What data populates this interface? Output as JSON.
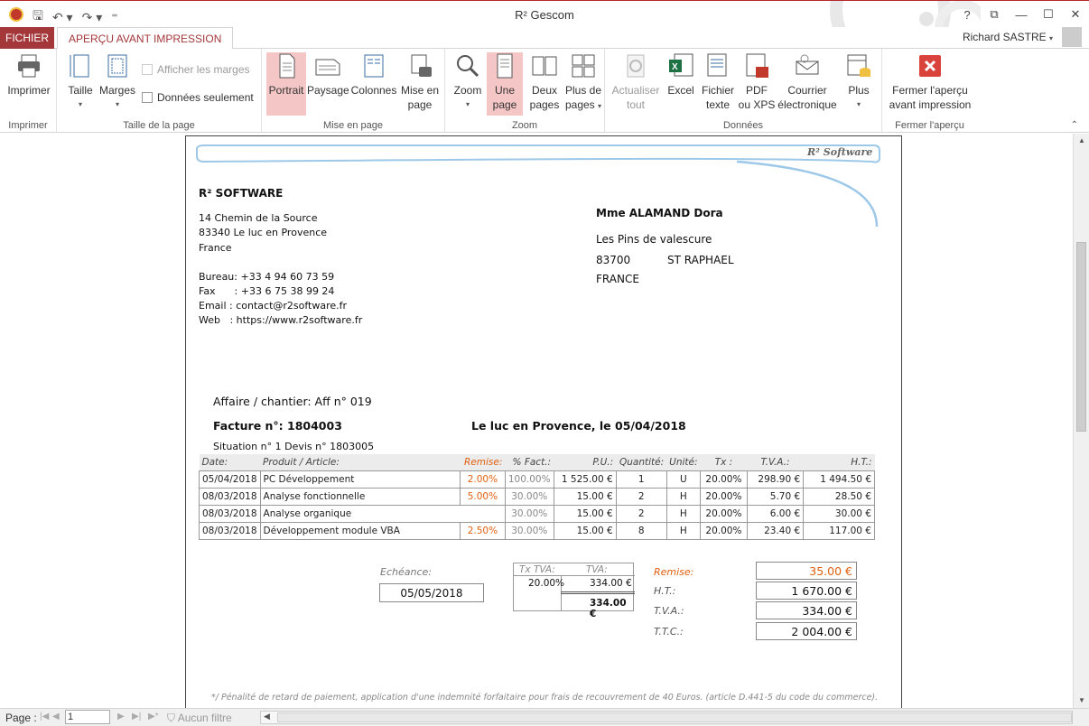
{
  "window": {
    "title": "R² Gescom",
    "user": "Richard SASTRE",
    "help": "?",
    "controls": {
      "restore": "⧉",
      "minimize": "—",
      "maximize": "☐",
      "close": "✕"
    }
  },
  "tabs": {
    "fichier": "FICHIER",
    "apercu": "APERÇU AVANT IMPRESSION"
  },
  "ribbon": {
    "imprimer": {
      "button": "Imprimer",
      "group": "Imprimer"
    },
    "taille": {
      "group": "Taille de la page",
      "taille": "Taille",
      "marges": "Marges",
      "afficher_marges": "Afficher les marges",
      "donnees_seulement": "Données seulement"
    },
    "mise_en_page": {
      "group": "Mise en page",
      "portrait": "Portrait",
      "paysage": "Paysage",
      "colonnes": "Colonnes",
      "mise_en_page_1": "Mise en",
      "mise_en_page_2": "page"
    },
    "zoom": {
      "group": "Zoom",
      "zoom": "Zoom",
      "une_page_1": "Une",
      "une_page_2": "page",
      "deux_pages_1": "Deux",
      "deux_pages_2": "pages",
      "plus_pages_1": "Plus de",
      "plus_pages_2": "pages"
    },
    "donnees": {
      "group": "Données",
      "actualiser_1": "Actualiser",
      "actualiser_2": "tout",
      "excel": "Excel",
      "fichier_1": "Fichier",
      "fichier_2": "texte",
      "pdf_1": "PDF",
      "pdf_2": "ou XPS",
      "courrier_1": "Courrier",
      "courrier_2": "électronique",
      "plus": "Plus"
    },
    "fermer": {
      "group": "Fermer l'aperçu",
      "btn_1": "Fermer l'aperçu",
      "btn_2": "avant impression"
    }
  },
  "invoice": {
    "logo_text": "R² Software",
    "company": "R² SOFTWARE",
    "address": [
      "14 Chemin de la Source",
      "83340 Le luc en Provence",
      "France"
    ],
    "contacts": [
      "Bureau: +33 4 94 60 73 59",
      "Fax      : +33 6 75 38 99 24",
      "Email : contact@r2software.fr",
      "Web   : https://www.r2software.fr"
    ],
    "client": {
      "name": "Mme ALAMAND Dora",
      "line1": "Les Pins de valescure",
      "zip": "83700",
      "city": "ST RAPHAEL",
      "country": "FRANCE"
    },
    "affaire": "Affaire / chantier:  Aff n° 019",
    "facture": "Facture n°:  1804003",
    "lieu_date": "Le luc en Provence, le  05/04/2018",
    "situation": "Situation n° 1    Devis n° 1803005",
    "headers": [
      "Date:",
      "Produit / Article:",
      "Remise:",
      "% Fact.:",
      "P.U.:",
      "Quantité:",
      "Unité:",
      "Tx :",
      "T.V.A.:",
      "H.T.:"
    ],
    "rows": [
      [
        "05/04/2018",
        "PC Développement",
        "2.00%",
        "100.00%",
        "1 525.00 €",
        "1",
        "U",
        "20.00%",
        "298.90 €",
        "1 494.50 €"
      ],
      [
        "08/03/2018",
        "Analyse fonctionnelle",
        "5.00%",
        "30.00%",
        "15.00 €",
        "2",
        "H",
        "20.00%",
        "5.70 €",
        "28.50 €"
      ],
      [
        "08/03/2018",
        "Analyse organique",
        "",
        "30.00%",
        "15.00 €",
        "2",
        "H",
        "20.00%",
        "6.00 €",
        "30.00 €"
      ],
      [
        "08/03/2018",
        "Développement module VBA",
        "2.50%",
        "30.00%",
        "15.00 €",
        "8",
        "H",
        "20.00%",
        "23.40 €",
        "117.00 €"
      ]
    ],
    "echeance_label": "Echéance:",
    "echeance": "05/05/2018",
    "tva_table": {
      "h1": "Tx TVA:",
      "h2": "TVA:",
      "rate": "20.00%",
      "amount": "334.00 €",
      "total": "334.00 €"
    },
    "totals": {
      "remise_label": "Remise:",
      "remise": "35.00 €",
      "ht_label": "H.T.:",
      "ht": "1 670.00 €",
      "tva_label": "T.V.A.:",
      "tva": "334.00 €",
      "ttc_label": "T.T.C.:",
      "ttc": "2 004.00 €"
    },
    "penalty": "*/ Pénalité de retard de paiement, application d'une indemnité forfaitaire pour frais de recouvrement de 40 Euros. (article D.441-5 du code du commerce)."
  },
  "status": {
    "page_label": "Page :",
    "page_value": "1",
    "filter": "Aucun filtre"
  },
  "colors": {
    "accent": "#a4373a",
    "orange": "#e06010",
    "selected": "#f5c6c6"
  }
}
